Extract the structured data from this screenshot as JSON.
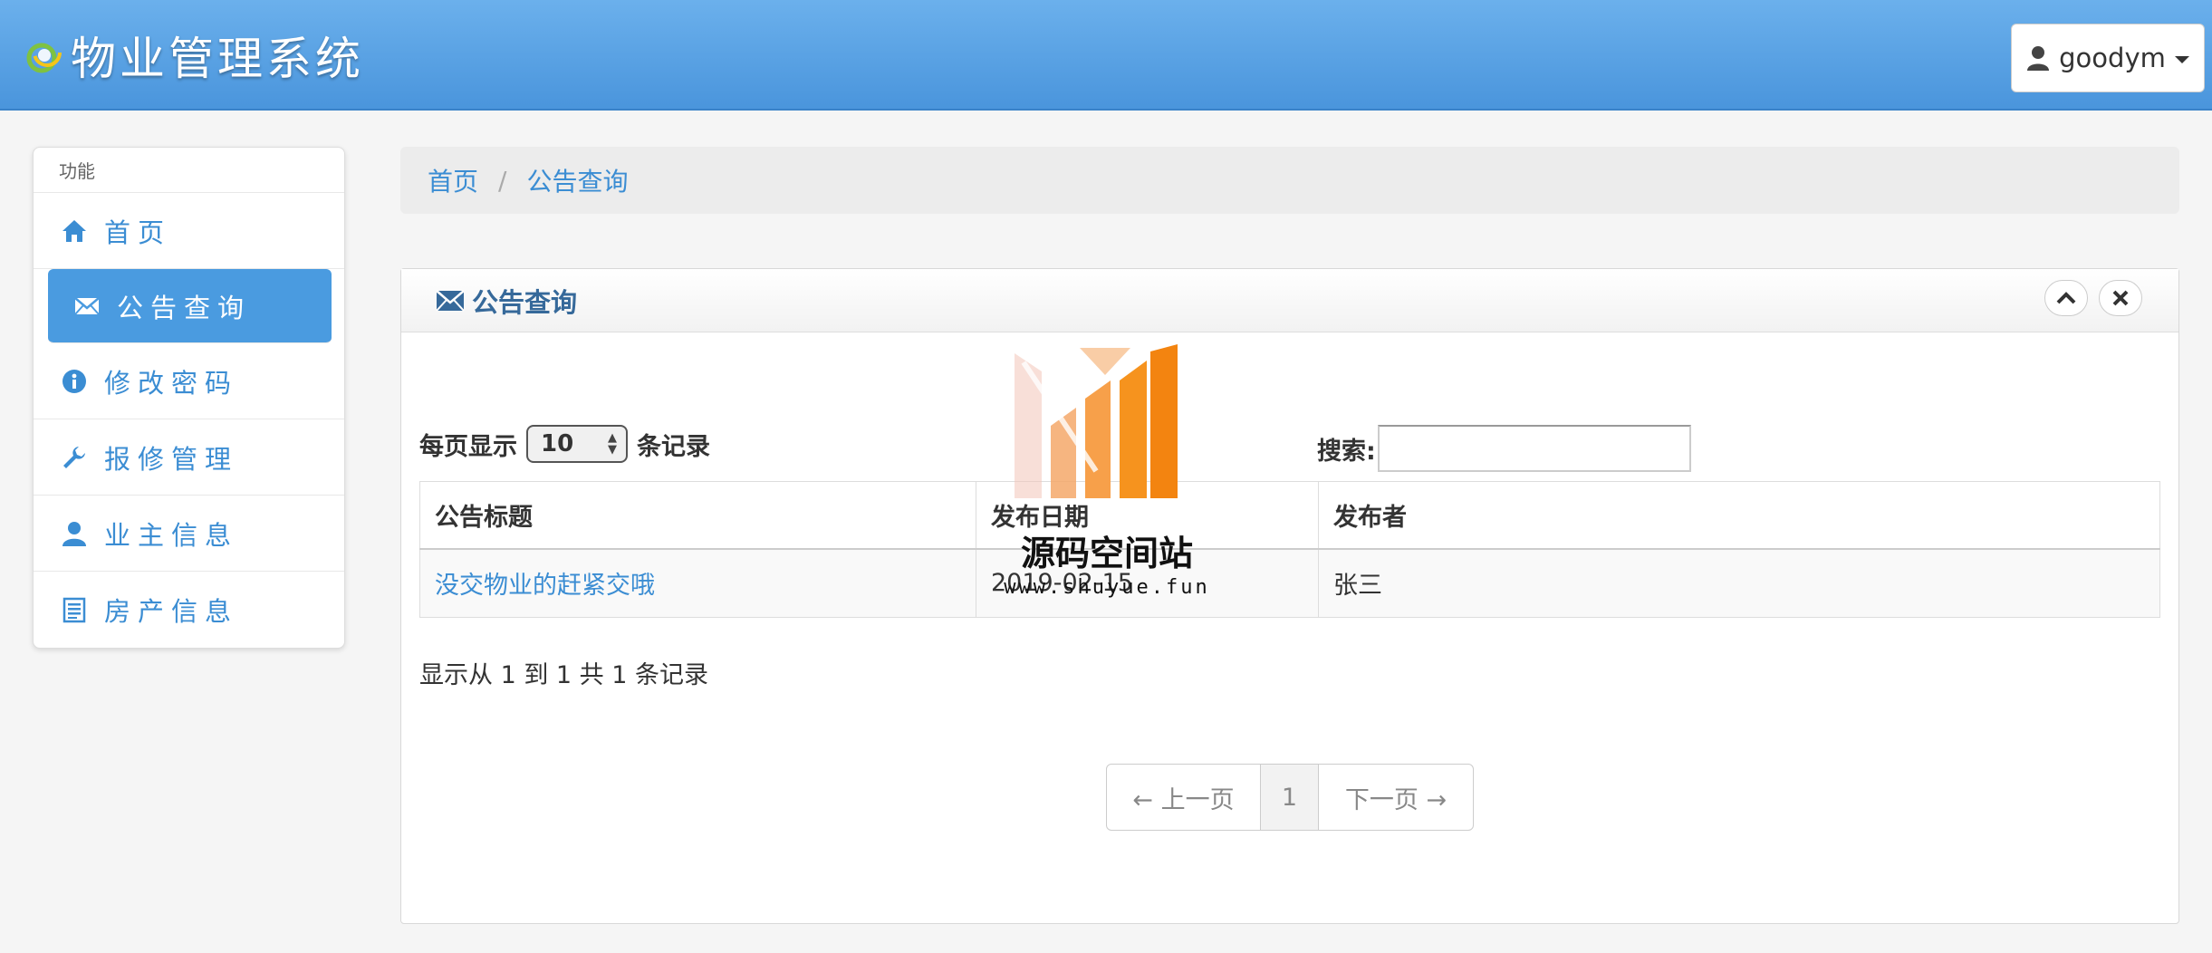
{
  "header": {
    "title": "物业管理系统",
    "username": "goodym"
  },
  "sidebar": {
    "heading": "功能",
    "items": [
      {
        "label": "首页",
        "icon": "home-icon"
      },
      {
        "label": "公告查询",
        "icon": "envelope-icon",
        "active": true
      },
      {
        "label": "修改密码",
        "icon": "info-icon"
      },
      {
        "label": "报修管理",
        "icon": "wrench-icon"
      },
      {
        "label": "业主信息",
        "icon": "user-icon"
      },
      {
        "label": "房产信息",
        "icon": "list-icon"
      }
    ]
  },
  "breadcrumb": {
    "home": "首页",
    "separator": "/",
    "current": "公告查询"
  },
  "panel": {
    "title": "公告查询"
  },
  "list_controls": {
    "per_page_prefix": "每页显示",
    "per_page_value": "10",
    "per_page_suffix": "条记录",
    "search_label": "搜索:",
    "search_value": ""
  },
  "table": {
    "columns": [
      "公告标题",
      "发布日期",
      "发布者"
    ],
    "rows": [
      {
        "title": "没交物业的赶紧交哦",
        "date": "2019-02-15",
        "publisher": "张三"
      }
    ]
  },
  "info_text": "显示从 1 到 1 共 1 条记录",
  "pagination": {
    "prev": "← 上一页",
    "current": "1",
    "next": "下一页 →"
  },
  "watermark": {
    "text": "源码空间站",
    "url": "www.shuyue.fun"
  },
  "colors": {
    "navbar": "#4a95dc",
    "accent": "#3b8dd3",
    "active_item": "#4a9be0"
  }
}
